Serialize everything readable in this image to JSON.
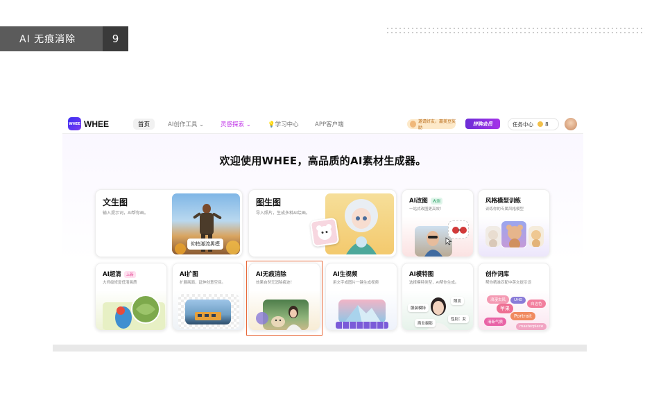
{
  "slide": {
    "tag": "AI 无痕消除",
    "page": "9"
  },
  "nav": {
    "logo_mark": "WHEE",
    "logo_text": "WHEE",
    "home": "首页",
    "ai_tools": "AI创作工具 ⌄",
    "inspiration": "灵感探索 ⌄",
    "learn": "💡学习中心",
    "app": "APP客户端",
    "invite": "邀请好友，赢美豆奖励",
    "vip": "拼购会员",
    "task": "任务中心",
    "beans": "8"
  },
  "headline": "欢迎使用WHEE，高品质的AI素材生成器。",
  "cards": {
    "text2img": {
      "title": "文生图",
      "desc": "输入提示词，AI帮你画。",
      "caption": "仰拍潮流男模"
    },
    "img2img": {
      "title": "图生图",
      "desc": "导入照片，生成多种AI绘画。"
    },
    "ai_edit": {
      "title": "AI改图",
      "badge": "内测",
      "desc": "一站式改图更高效！"
    },
    "style_train": {
      "title": "风格模型训练",
      "desc": "训练你的专属风格模型"
    },
    "upscale": {
      "title": "AI超清",
      "badge": "上新",
      "desc": "大师级修复低清画质"
    },
    "expand": {
      "title": "AI扩图",
      "desc": "扩展画面，延伸创意空间。"
    },
    "erase": {
      "title": "AI无痕消除",
      "desc": "效果自然无消除痕迹！"
    },
    "video": {
      "title": "AI生视频",
      "desc": "用文字或图片一键生成视频"
    },
    "model": {
      "title": "AI模特图",
      "desc": "选择模特类型，AI帮你生成。",
      "tags": [
        "照发",
        "服装模特",
        "性别：女",
        "商业摄影"
      ]
    },
    "words": {
      "title": "创作词库",
      "desc": "帮你精准匹配中英文提示词",
      "chips": [
        "浪漫古风",
        "UHD",
        "苹果",
        "白洁色",
        "Portrait",
        "清新气质",
        "masterpiece"
      ]
    }
  },
  "colors": {
    "accent_purple": "#c034e8",
    "highlight_orange": "#e8693a"
  }
}
